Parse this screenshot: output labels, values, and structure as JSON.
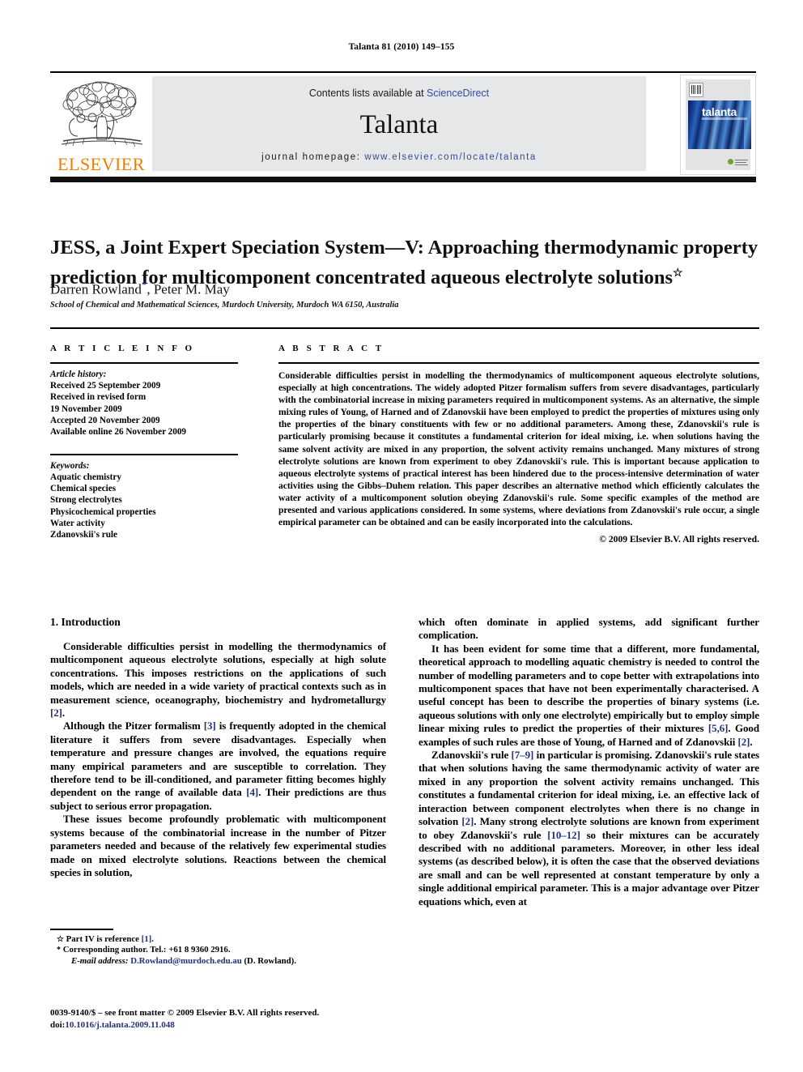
{
  "running_head": "Talanta 81 (2010) 149–155",
  "masthead": {
    "contents_prefix": "Contents lists available at ",
    "sciencedirect": "ScienceDirect",
    "journal_title": "Talanta",
    "homepage_label": "journal homepage:",
    "homepage_url": "www.elsevier.com/locate/talanta",
    "publisher_name": "ELSEVIER",
    "cover_word": "talanta",
    "sciencedirect_color": "#2f4ba0",
    "elsevier_orange": "#f07d00",
    "panel_gray": "#e6e7e9"
  },
  "article": {
    "title": "JESS, a Joint Expert Speciation System—V: Approaching thermodynamic property prediction for multicomponent concentrated aqueous electrolyte solutions",
    "title_footnote_mark": "☆",
    "authors": "Darren Rowland",
    "author_star": "*",
    "authors_rest": ", Peter M. May",
    "affiliation": "School of Chemical and Mathematical Sciences, Murdoch University, Murdoch WA 6150, Australia"
  },
  "article_info": {
    "label": "A R T I C L E   I N F O",
    "history_heading": "Article history:",
    "history": [
      "Received 25 September 2009",
      "Received in revised form",
      "19 November 2009",
      "Accepted 20 November 2009",
      "Available online 26 November 2009"
    ],
    "keywords_heading": "Keywords:",
    "keywords": [
      "Aquatic chemistry",
      "Chemical species",
      "Strong electrolytes",
      "Physicochemical properties",
      "Water activity",
      "Zdanovskii's rule"
    ]
  },
  "abstract": {
    "label": "A B S T R A C T",
    "text": "Considerable difficulties persist in modelling the thermodynamics of multicomponent aqueous electrolyte solutions, especially at high concentrations. The widely adopted Pitzer formalism suffers from severe disadvantages, particularly with the combinatorial increase in mixing parameters required in multicomponent systems. As an alternative, the simple mixing rules of Young, of Harned and of Zdanovskii have been employed to predict the properties of mixtures using only the properties of the binary constituents with few or no additional parameters. Among these, Zdanovskii's rule is particularly promising because it constitutes a fundamental criterion for ideal mixing, i.e. when solutions having the same solvent activity are mixed in any proportion, the solvent activity remains unchanged. Many mixtures of strong electrolyte solutions are known from experiment to obey Zdanovskii's rule. This is important because application to aqueous electrolyte systems of practical interest has been hindered due to the process-intensive determination of water activities using the Gibbs–Duhem relation. This paper describes an alternative method which efficiently calculates the water activity of a multicomponent solution obeying Zdanovskii's rule. Some specific examples of the method are presented and various applications considered. In some systems, where deviations from Zdanovskii's rule occur, a single empirical parameter can be obtained and can be easily incorporated into the calculations.",
    "copyright": "© 2009 Elsevier B.V. All rights reserved."
  },
  "body": {
    "section_heading": "1.  Introduction",
    "left_paragraphs": [
      {
        "parts": [
          {
            "t": "Considerable difficulties persist in modelling the thermodynamics of multicomponent aqueous electrolyte solutions, especially at high solute concentrations. This imposes restrictions on the applications of such models, which are needed in a wide variety of practical contexts such as in measurement science, oceanography, biochemistry and hydrometallurgy "
          },
          {
            "t": "[2]",
            "ref": true
          },
          {
            "t": "."
          }
        ]
      },
      {
        "parts": [
          {
            "t": "Although the Pitzer formalism "
          },
          {
            "t": "[3]",
            "ref": true
          },
          {
            "t": " is frequently adopted in the chemical literature it suffers from severe disadvantages. Especially when temperature and pressure changes are involved, the equations require many empirical parameters and are susceptible to correlation. They therefore tend to be ill-conditioned, and parameter fitting becomes highly dependent on the range of available data "
          },
          {
            "t": "[4]",
            "ref": true
          },
          {
            "t": ". Their predictions are thus subject to serious error propagation."
          }
        ]
      },
      {
        "parts": [
          {
            "t": "These issues become profoundly problematic with multicomponent systems because of the combinatorial increase in the number of Pitzer parameters needed and because of the relatively few experimental studies made on mixed electrolyte solutions. Reactions between the chemical species in solution,"
          }
        ]
      }
    ],
    "right_paragraphs": [
      {
        "noindent": true,
        "parts": [
          {
            "t": "which often dominate in applied systems, add significant further complication."
          }
        ]
      },
      {
        "parts": [
          {
            "t": "It has been evident for some time that a different, more fundamental, theoretical approach to modelling aquatic chemistry is needed to control the number of modelling parameters and to cope better with extrapolations into multicomponent spaces that have not been experimentally characterised. A useful concept has been to describe the properties of binary systems (i.e. aqueous solutions with only one electrolyte) empirically but to employ simple linear mixing rules to predict the properties of their mixtures "
          },
          {
            "t": "[5,6]",
            "ref": true
          },
          {
            "t": ". Good examples of such rules are those of Young, of Harned and of Zdanovskii "
          },
          {
            "t": "[2]",
            "ref": true
          },
          {
            "t": "."
          }
        ]
      },
      {
        "parts": [
          {
            "t": "Zdanovskii's rule "
          },
          {
            "t": "[7–9]",
            "ref": true
          },
          {
            "t": " in particular is promising. Zdanovskii's rule states that when solutions having the same thermodynamic activity of water are mixed in any proportion the solvent activity remains unchanged. This constitutes a fundamental criterion for ideal mixing, i.e. an effective lack of interaction between component electrolytes when there is no change in solvation "
          },
          {
            "t": "[2]",
            "ref": true
          },
          {
            "t": ". Many strong electrolyte solutions are known from experiment to obey Zdanovskii's rule "
          },
          {
            "t": "[10–12]",
            "ref": true
          },
          {
            "t": " so their mixtures can be accurately described with no additional parameters. Moreover, in other less ideal systems (as described below), it is often the case that the observed deviations are small and can be well represented at constant temperature by only a single additional empirical parameter. This is a major advantage over Pitzer equations which, even at"
          }
        ]
      }
    ]
  },
  "footnotes": {
    "part_mark": "☆",
    "part_text_prefix": "Part IV is reference ",
    "part_ref": "[1]",
    "part_text_suffix": ".",
    "corresponding_mark": "*",
    "corresponding_text": "Corresponding author. Tel.: +61 8 9360 2916.",
    "email_label": "E-mail address:",
    "email": "D.Rowland@murdoch.edu.au",
    "email_suffix": "(D. Rowland)."
  },
  "imprint": {
    "issn_line": "0039-9140/$ – see front matter © 2009 Elsevier B.V. All rights reserved.",
    "doi_prefix": "doi:",
    "doi": "10.1016/j.talanta.2009.11.048"
  }
}
